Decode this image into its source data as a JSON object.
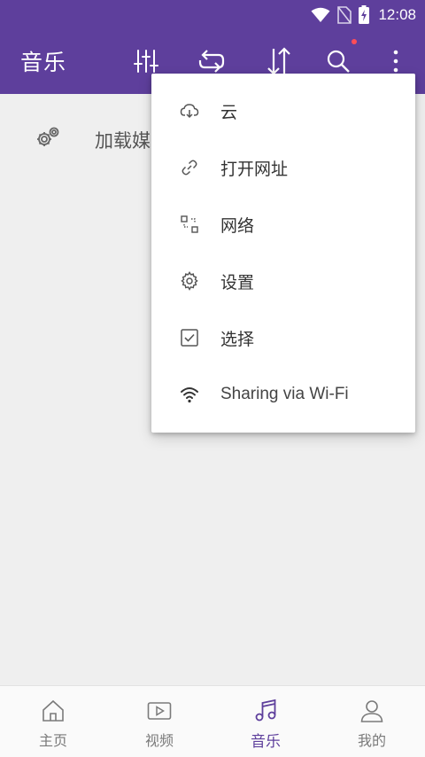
{
  "status_bar": {
    "time": "12:08",
    "icons": [
      "wifi-icon",
      "no-sim-icon",
      "battery-charging-icon"
    ]
  },
  "app_bar": {
    "title": "音乐",
    "actions": [
      "equalizer-icon",
      "repeat-icon",
      "sort-icon",
      "search-icon",
      "more-vert-icon"
    ],
    "search_badge_color": "#ff4d57"
  },
  "content": {
    "load_media_label": "加载媒",
    "icon": "gears-icon"
  },
  "overflow_menu": {
    "items": [
      {
        "label": "云",
        "icon": "cloud-download-icon"
      },
      {
        "label": "打开网址",
        "icon": "link-icon"
      },
      {
        "label": "网络",
        "icon": "network-icon"
      },
      {
        "label": "设置",
        "icon": "gear-icon"
      },
      {
        "label": "选择",
        "icon": "checkbox-icon"
      },
      {
        "label": "Sharing via Wi-Fi",
        "icon": "wifi-icon"
      }
    ]
  },
  "bottom_nav": {
    "items": [
      {
        "label": "主页",
        "icon": "home-icon"
      },
      {
        "label": "视频",
        "icon": "video-icon"
      },
      {
        "label": "音乐",
        "icon": "music-note-icon"
      },
      {
        "label": "我的",
        "icon": "person-icon"
      }
    ],
    "active_index": 2
  },
  "colors": {
    "primary": "#5e3f9c",
    "background": "#efefef",
    "menu_background": "#ffffff",
    "text": "#333333"
  }
}
